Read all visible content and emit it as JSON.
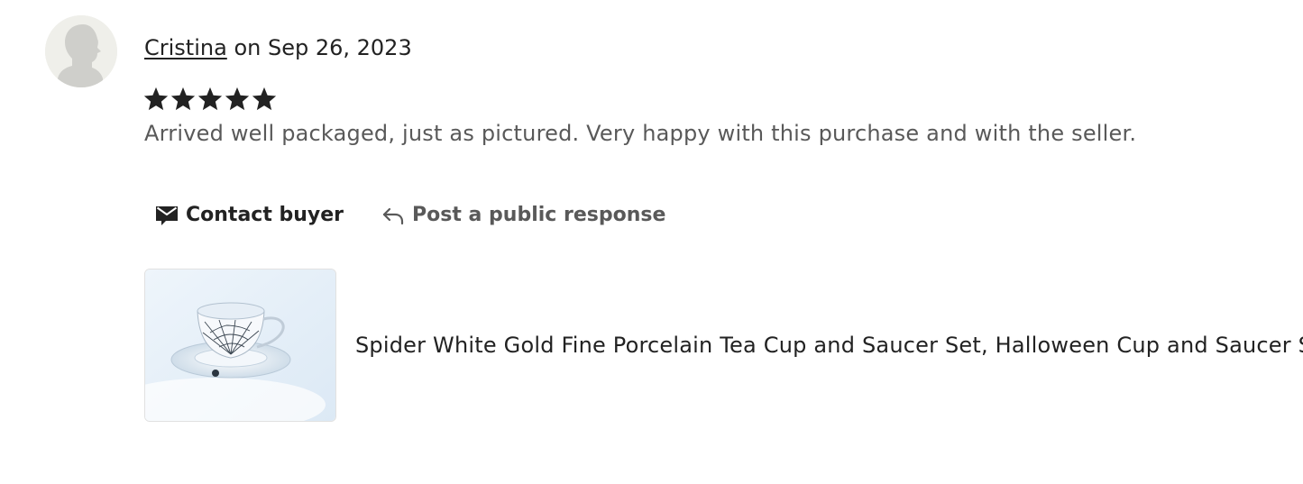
{
  "review": {
    "author": "Cristina",
    "date_prefix": "on",
    "date": "Sep 26, 2023",
    "rating": 5,
    "max_rating": 5,
    "text": "Arrived well packaged, just as pictured. Very happy with this purchase and with the seller."
  },
  "actions": {
    "contact_label": "Contact buyer",
    "contact_icon": "envelope-icon",
    "respond_label": "Post a public response",
    "respond_icon": "reply-arrow-icon"
  },
  "listing": {
    "title": "Spider White Gold Fine Porcelain Tea Cup and Saucer Set, Halloween Cup and Saucer Set"
  },
  "colors": {
    "text_primary": "#222222",
    "text_secondary": "#595959",
    "star": "#222222",
    "avatar_bg": "#efefea",
    "avatar_silhouette": "#cfcfcb"
  }
}
